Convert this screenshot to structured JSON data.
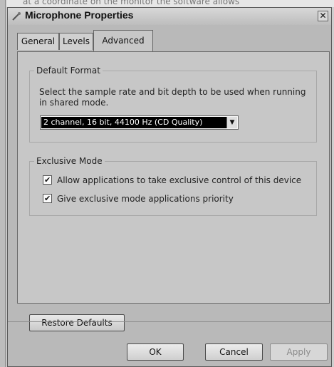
{
  "background": {
    "text": "at a coordinate on the monitor the software allows"
  },
  "dialog": {
    "title": "Microphone Properties",
    "close_symbol": "✕",
    "tabs": [
      {
        "label": "General"
      },
      {
        "label": "Levels"
      },
      {
        "label": "Advanced"
      }
    ],
    "default_format": {
      "label": "Default Format",
      "description": "Select the sample rate and bit depth to be used when running in shared mode.",
      "selected_value": "2 channel, 16 bit, 44100 Hz (CD Quality)"
    },
    "exclusive_mode": {
      "label": "Exclusive Mode",
      "options": [
        {
          "label": "Allow applications to take exclusive control of this device",
          "checked": true
        },
        {
          "label": "Give exclusive mode applications priority",
          "checked": true
        }
      ]
    },
    "restore_defaults_label": "Restore Defaults",
    "buttons": {
      "ok": "OK",
      "cancel": "Cancel",
      "apply": "Apply"
    }
  },
  "icons": {
    "microphone": "microphone-icon",
    "close": "close-icon",
    "dropdown": "chevron-down-icon",
    "checkbox": "checkmark-icon"
  }
}
